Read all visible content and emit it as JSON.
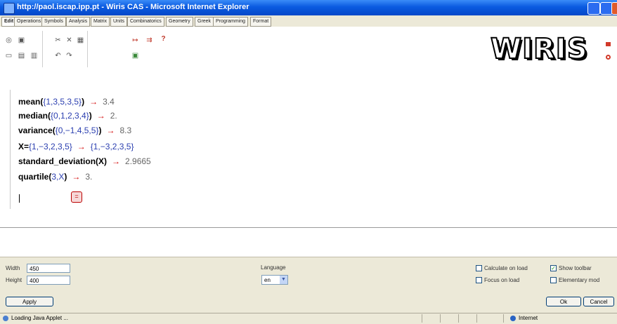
{
  "window": {
    "title": "http://paol.iscap.ipp.pt - Wiris CAS - Microsoft Internet Explorer"
  },
  "tabs": [
    "Edit",
    "Operations",
    "Symbols",
    "Analysis",
    "Matrix",
    "Units",
    "Combinatorics",
    "Geometry",
    "Greek",
    "Programming",
    "Format"
  ],
  "active_tab": "Edit",
  "toolbar": {
    "icons": [
      "new-icon",
      "open-icon",
      "cut-icon",
      "delete-icon",
      "copy-icon",
      "print-icon",
      "paste-icon",
      "undo-icon",
      "redo-icon",
      "calculate-icon",
      "calculate-all-icon",
      "help-icon",
      "block-icon"
    ],
    "help_glyph": "?"
  },
  "logo": {
    "text": "WIRIS"
  },
  "worksheet": {
    "lines": [
      {
        "fn": "mean(",
        "args": "{1,3,5,3,5}",
        "close": ")",
        "result": "3.4"
      },
      {
        "fn": "median(",
        "args": "{0,1,2,3,4}",
        "close": ")",
        "result": "2."
      },
      {
        "fn": "variance(",
        "args": "{0,−1,4,5,5}",
        "close": ")",
        "result": "8.3"
      },
      {
        "fn": "X=",
        "args": "{1,−3,2,3,5}",
        "close": "",
        "result": "{1,−3,2,3,5}"
      },
      {
        "fn": "standard_deviation(X)",
        "args": "",
        "close": "",
        "result": "2.9665"
      },
      {
        "fn": "quartile(",
        "args": "3,X",
        "close": ")",
        "result": "3."
      }
    ],
    "arrow": "→",
    "calc_button_glyph": "="
  },
  "settings": {
    "width_label": "Width",
    "width_value": "450",
    "height_label": "Height",
    "height_value": "400",
    "language_label": "Language",
    "language_value": "en",
    "calculate_on_load_label": "Calculate on load",
    "calculate_on_load": false,
    "show_toolbar_label": "Show toolbar",
    "show_toolbar": true,
    "focus_on_load_label": "Focus on load",
    "focus_on_load": false,
    "elementary_mode_label": "Elementary mod",
    "elementary_mode": false
  },
  "buttons": {
    "apply": "Apply",
    "ok": "Ok",
    "cancel": "Cancel"
  },
  "status": {
    "text": "Loading Java Applet ...",
    "zone": "Internet"
  },
  "colors": {
    "title_bar": "#0a5ae0",
    "arrow": "#d20000",
    "args": "#2b3fb0",
    "logo_accent": "#d23a2a"
  }
}
